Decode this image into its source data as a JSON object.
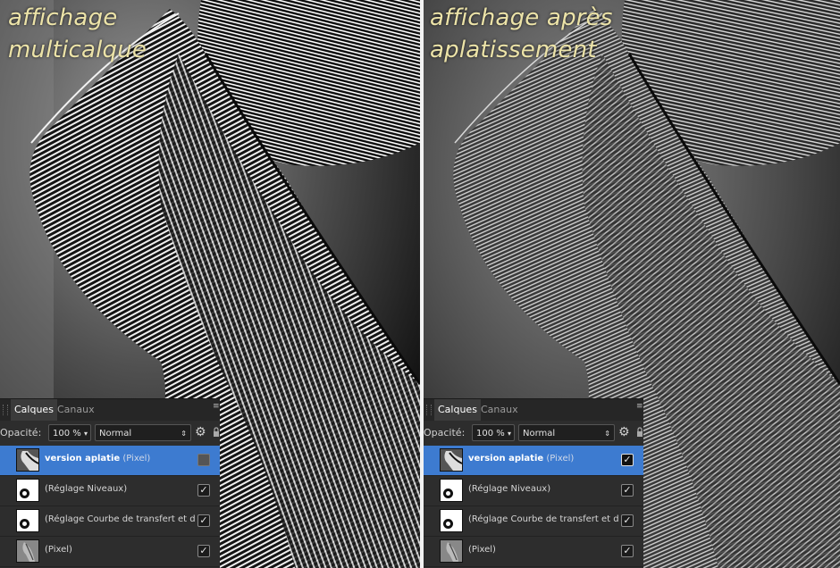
{
  "left": {
    "caption_line1": "affichage",
    "caption_line2": "multicalque",
    "panel": {
      "tab_active": "Calques",
      "tab_inactive": "Canaux",
      "opacity_label": "Opacité:",
      "opacity_value": "100 %",
      "blend_mode": "Normal",
      "layers": [
        {
          "name": "version aplatie",
          "type": "(Pixel)",
          "selected": true,
          "visible": false
        },
        {
          "name": "",
          "type": "(Réglage Niveaux)",
          "selected": false,
          "visible": true
        },
        {
          "name": "",
          "type": "(Réglage Courbe de transfert et de",
          "selected": false,
          "visible": true
        },
        {
          "name": "",
          "type": "(Pixel)",
          "selected": false,
          "visible": true
        }
      ]
    }
  },
  "right": {
    "caption_line1": "affichage après",
    "caption_line2": "aplatissement",
    "panel": {
      "tab_active": "Calques",
      "tab_inactive": "Canaux",
      "opacity_label": "Opacité:",
      "opacity_value": "100 %",
      "blend_mode": "Normal",
      "layers": [
        {
          "name": "version aplatie",
          "type": "(Pixel)",
          "selected": true,
          "visible": true
        },
        {
          "name": "",
          "type": "(Réglage Niveaux)",
          "selected": false,
          "visible": true
        },
        {
          "name": "",
          "type": "(Réglage Courbe de transfert et de",
          "selected": false,
          "visible": true
        },
        {
          "name": "",
          "type": "(Pixel)",
          "selected": false,
          "visible": true
        }
      ]
    }
  },
  "icons": {
    "check": "✓",
    "dropdown": "▾",
    "stepper": "⇕",
    "gear": "⚙",
    "lock": "🔒",
    "menu": "≡"
  }
}
